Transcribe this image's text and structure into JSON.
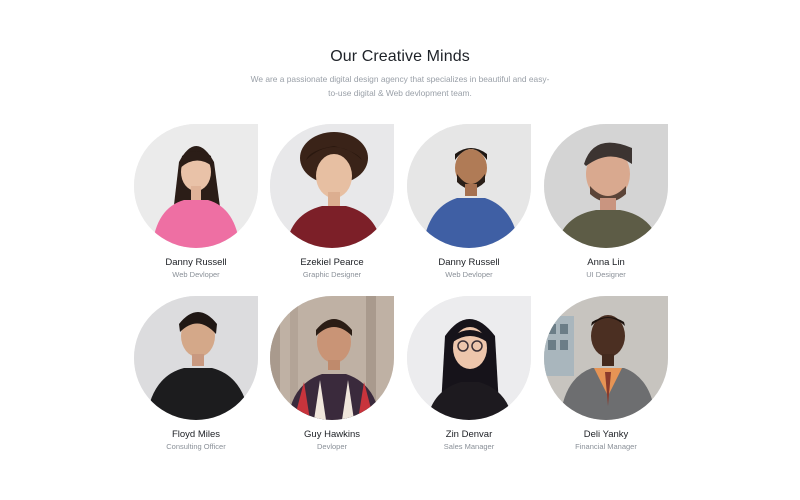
{
  "section": {
    "title": "Our Creative Minds",
    "subtitle": "We are a passionate digital design agency that specializes in beautiful and easy-to-use digital & Web devlopment team."
  },
  "team": [
    {
      "name": "Danny Russell",
      "role": "Web Devloper"
    },
    {
      "name": "Ezekiel Pearce",
      "role": "Graphic Designer"
    },
    {
      "name": "Danny Russell",
      "role": "Web Devloper"
    },
    {
      "name": "Anna Lin",
      "role": "UI Designer"
    },
    {
      "name": "Floyd Miles",
      "role": "Consulting Officer"
    },
    {
      "name": "Guy Hawkins",
      "role": "Devloper"
    },
    {
      "name": "Zin Denvar",
      "role": "Sales Manager"
    },
    {
      "name": "Deli Yanky",
      "role": "Financial Manager"
    }
  ]
}
